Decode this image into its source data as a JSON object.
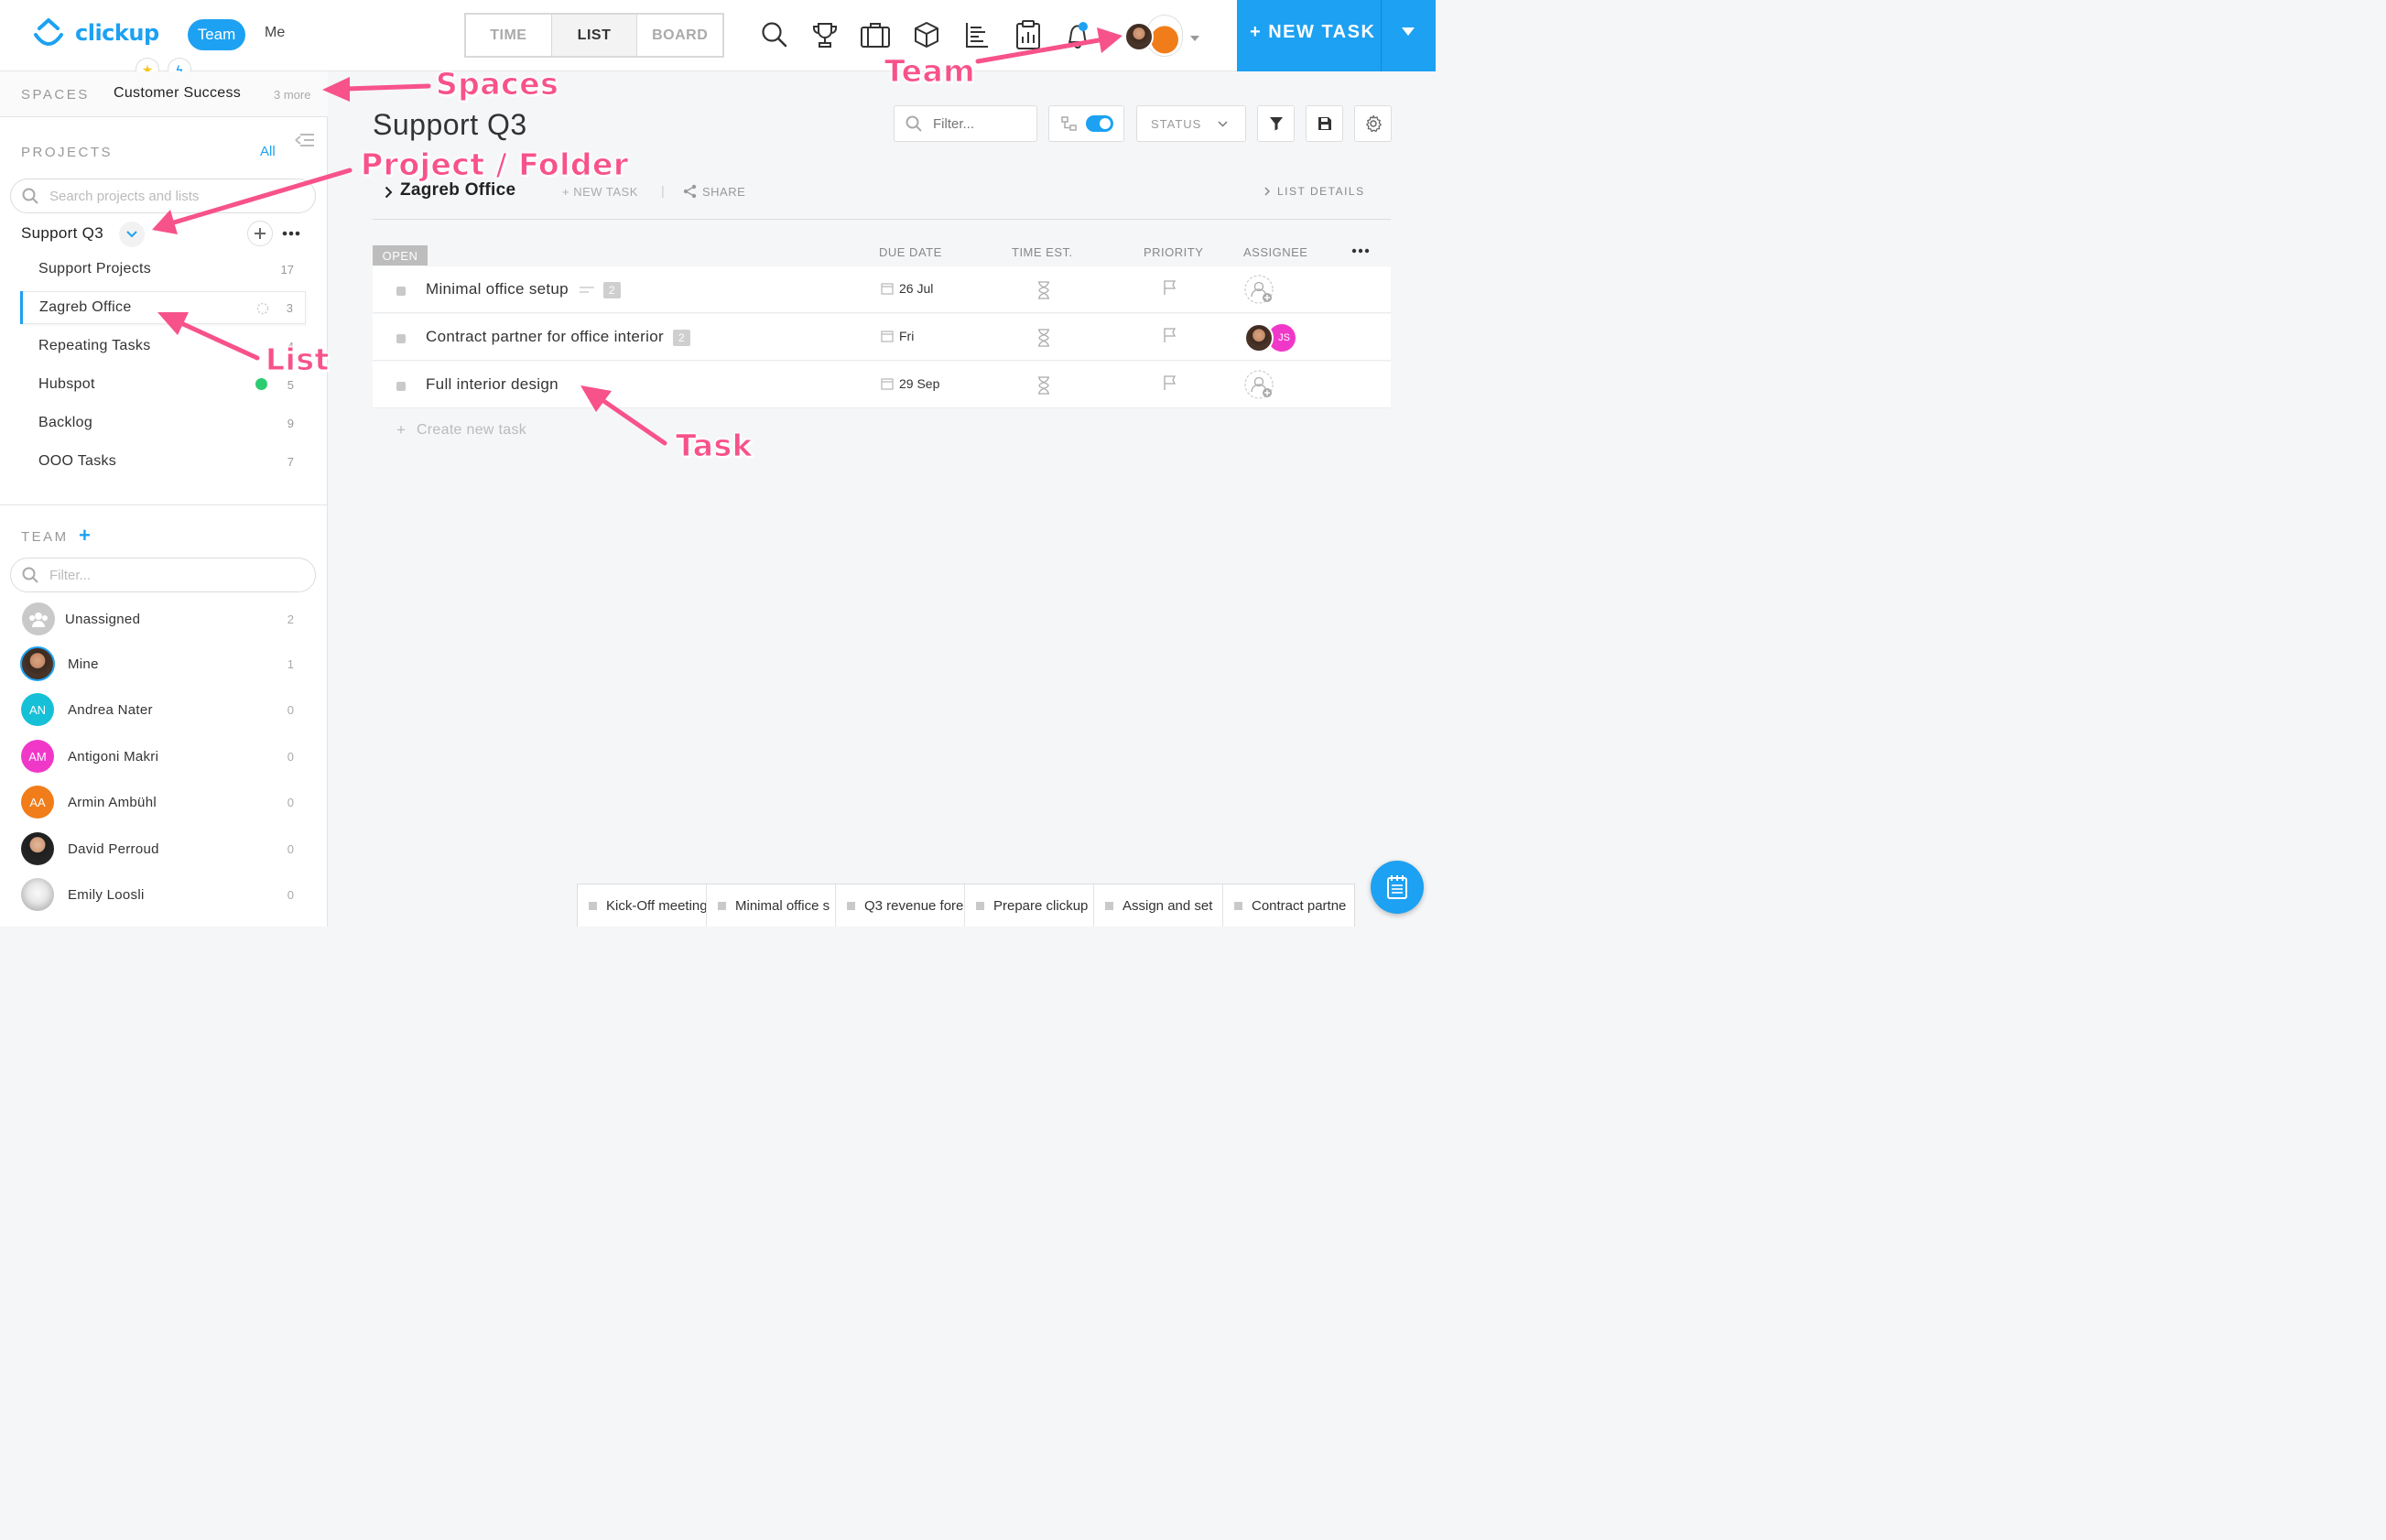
{
  "header": {
    "brand": "clickup",
    "team_tab": "Team",
    "me_tab": "Me",
    "views": [
      "TIME",
      "LIST",
      "BOARD"
    ],
    "active_view": "LIST",
    "new_task_label": "+ NEW TASK",
    "icons": [
      "search-icon",
      "trophy-icon",
      "briefcase-icon",
      "box-icon",
      "gantt-icon",
      "clipboard-icon",
      "bell-icon"
    ]
  },
  "sidebar": {
    "spaces_label": "SPACES",
    "current_space": "Customer Success",
    "more_spaces": "3 more",
    "projects_label": "PROJECTS",
    "projects_filter": "All",
    "search_placeholder": "Search projects and lists",
    "project_name": "Support Q3",
    "lists": [
      {
        "name": "Support Projects",
        "count": "17"
      },
      {
        "name": "Zagreb Office",
        "count": "3"
      },
      {
        "name": "Repeating Tasks",
        "count": "4"
      },
      {
        "name": "Hubspot",
        "count": "5"
      },
      {
        "name": "Backlog",
        "count": "9"
      },
      {
        "name": "OOO Tasks",
        "count": "7"
      }
    ],
    "team_label": "TEAM",
    "team_filter_placeholder": "Filter...",
    "members": [
      {
        "name": "Unassigned",
        "count": "2"
      },
      {
        "name": "Mine",
        "count": "1"
      },
      {
        "name": "Andrea Nater",
        "count": "0",
        "initials": "AN",
        "color": "#16c0d6"
      },
      {
        "name": "Antigoni Makri",
        "count": "0",
        "initials": "AM",
        "color": "#f038c8"
      },
      {
        "name": "Armin Ambühl",
        "count": "0",
        "initials": "AA",
        "color": "#f07d1a"
      },
      {
        "name": "David Perroud",
        "count": "0"
      },
      {
        "name": "Emily Loosli",
        "count": "0"
      }
    ]
  },
  "main": {
    "title": "Support Q3",
    "filter_placeholder": "Filter...",
    "status_label": "STATUS",
    "list_name": "Zagreb Office",
    "new_task_link": "+ NEW TASK",
    "share_link": "SHARE",
    "list_details": "LIST DETAILS",
    "status_group": "OPEN",
    "columns": {
      "due": "DUE DATE",
      "time": "TIME EST.",
      "priority": "PRIORITY",
      "assignee": "ASSIGNEE"
    },
    "tasks": [
      {
        "name": "Minimal office setup",
        "subtasks": "2",
        "due": "26 Jul"
      },
      {
        "name": "Contract partner for office interior",
        "subtasks": "2",
        "due": "Fri",
        "assignee_initials": "JS"
      },
      {
        "name": "Full interior design",
        "due": "29 Sep"
      }
    ],
    "create_task": "Create new task"
  },
  "annotations": {
    "spaces": "Spaces",
    "team": "Team",
    "project": "Project / Folder",
    "list": "List",
    "task": "Task"
  },
  "tray": [
    "Kick-Off meeting",
    "Minimal office s",
    "Q3 revenue fore",
    "Prepare clickup",
    "Assign and set",
    "Contract partne"
  ],
  "colors": {
    "accent": "#1da1f2",
    "annotation": "#f7528a",
    "green_dot": "#2ecc71"
  }
}
